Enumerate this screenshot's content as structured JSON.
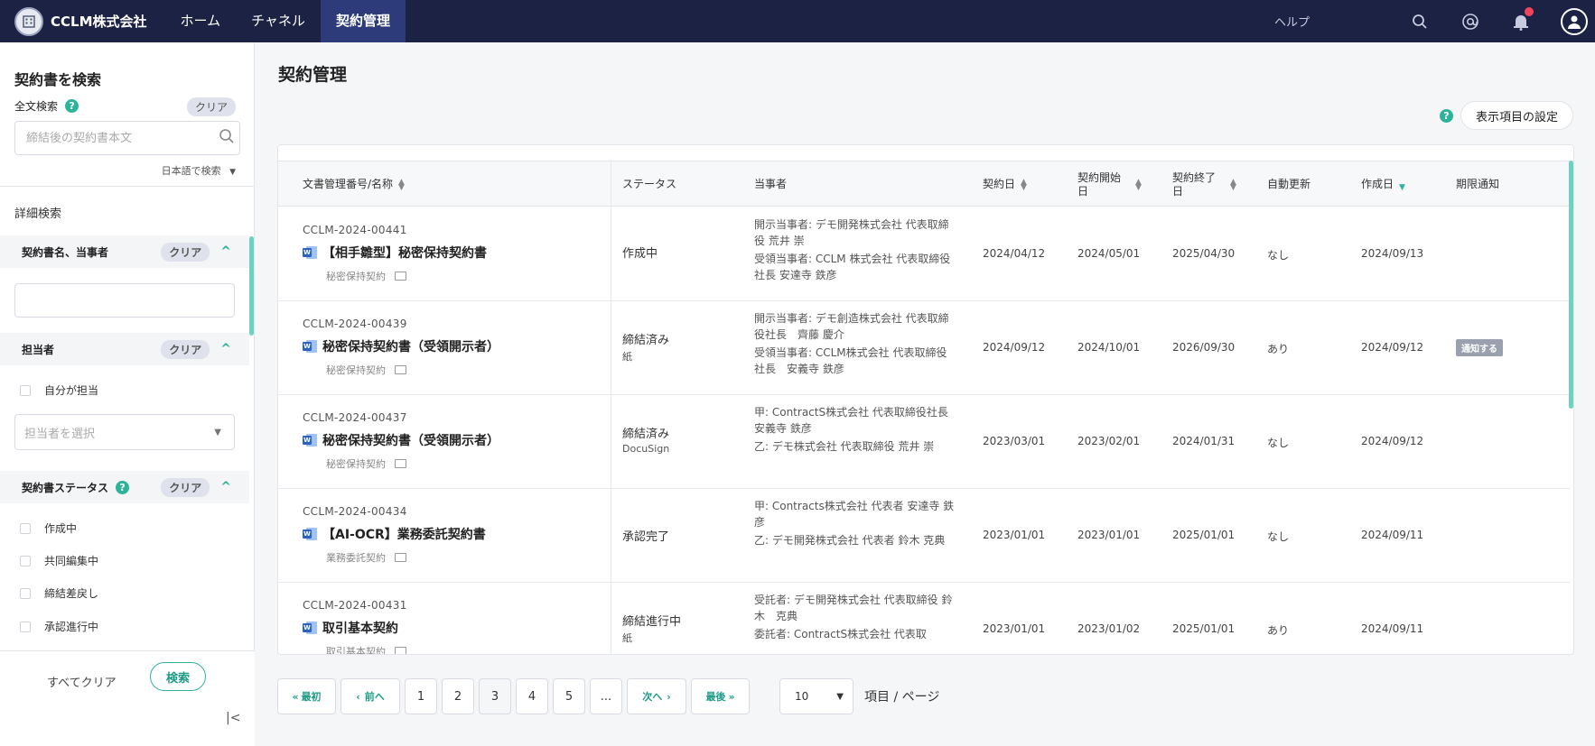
{
  "header": {
    "company": "CCLM株式会社",
    "nav": [
      {
        "label": "ホーム",
        "active": false
      },
      {
        "label": "チャネル",
        "active": false
      },
      {
        "label": "契約管理",
        "active": true
      }
    ],
    "help": "ヘルプ",
    "icons": [
      "building-icon",
      "search-icon",
      "mention-icon",
      "bell-icon",
      "user-icon"
    ],
    "colors": {
      "bar": "#1b2243",
      "active": "#2e3b7a",
      "accent": "#2fb29a",
      "notification": "#f0445b"
    }
  },
  "sidebar": {
    "title": "契約書を検索",
    "fulltext_label": "全文検索",
    "help_glyph": "?",
    "clear": "クリア",
    "search_placeholder": "締結後の契約書本文",
    "lang_select": "日本語で検索",
    "advanced_title": "詳細検索",
    "sections": {
      "name_party": {
        "title": "契約書名、当事者",
        "clear": "クリア"
      },
      "owner": {
        "title": "担当者",
        "clear": "クリア",
        "self_label": "自分が担当",
        "select_placeholder": "担当者を選択"
      },
      "status": {
        "title": "契約書ステータス",
        "clear": "クリア",
        "options": [
          "作成中",
          "共同編集中",
          "締結差戻し",
          "承認進行中"
        ]
      }
    },
    "clear_all": "すべてクリア",
    "search_button": "検索",
    "collapse_glyph": "|<"
  },
  "main": {
    "title": "契約管理",
    "help_glyph": "?",
    "display_settings": "表示項目の設定",
    "columns": {
      "doc": "文書管理番号/名称",
      "status": "ステータス",
      "parties": "当事者",
      "contract_date": "契約日",
      "start_date_1": "契約開始",
      "start_date_2": "日",
      "end_date_1": "契約終了",
      "end_date_2": "日",
      "auto_renew": "自動更新",
      "created": "作成日",
      "expiry_notice": "期限通知"
    },
    "rows": [
      {
        "no": "CCLM-2024-00441",
        "name": "【相手雛型】秘密保持契約書",
        "type": "秘密保持契約",
        "status": "作成中",
        "status_sub": "",
        "parties": [
          "開示当事者: デモ開発株式会社 代表取締役 荒井 崇",
          "受領当事者: CCLM 株式会社 代表取締役社長 安達寺 鉄彦"
        ],
        "contract_date": "2024/04/12",
        "start_date": "2024/05/01",
        "end_date": "2025/04/30",
        "auto_renew": "なし",
        "created": "2024/09/13",
        "notice": ""
      },
      {
        "no": "CCLM-2024-00439",
        "name": "秘密保持契約書（受領開示者）",
        "type": "秘密保持契約",
        "status": "締結済み",
        "status_sub": "紙",
        "parties": [
          "開示当事者: デモ創造株式会社 代表取締役社長　齊藤 慶介",
          "受領当事者: CCLM株式会社 代表取締役社長　安義寺 鉄彦"
        ],
        "contract_date": "2024/09/12",
        "start_date": "2024/10/01",
        "end_date": "2026/09/30",
        "auto_renew": "あり",
        "created": "2024/09/12",
        "notice": "通知する"
      },
      {
        "no": "CCLM-2024-00437",
        "name": "秘密保持契約書（受領開示者）",
        "type": "秘密保持契約",
        "status": "締結済み",
        "status_sub": "DocuSign",
        "parties": [
          "甲: ContractS株式会社 代表取締役社長 安義寺 鉄彦",
          "乙: デモ株式会社 代表取締役 荒井 崇"
        ],
        "contract_date": "2023/03/01",
        "start_date": "2023/02/01",
        "end_date": "2024/01/31",
        "auto_renew": "なし",
        "created": "2024/09/12",
        "notice": ""
      },
      {
        "no": "CCLM-2024-00434",
        "name": "【AI-OCR】業務委託契約書",
        "type": "業務委託契約",
        "status": "承認完了",
        "status_sub": "",
        "parties": [
          "甲: Contracts株式会社 代表者 安達寺 鉄彦",
          "乙: デモ開発株式会社 代表者 鈴木 克典"
        ],
        "contract_date": "2023/01/01",
        "start_date": "2023/01/01",
        "end_date": "2025/01/01",
        "auto_renew": "なし",
        "created": "2024/09/11",
        "notice": ""
      },
      {
        "no": "CCLM-2024-00431",
        "name": "取引基本契約",
        "type": "取引基本契約",
        "status": "締結進行中",
        "status_sub": "紙",
        "parties": [
          "受託者: デモ開発株式会社 代表取締役 鈴木　克典",
          "委託者: ContractS株式会社 代表取"
        ],
        "contract_date": "2023/01/01",
        "start_date": "2023/01/02",
        "end_date": "2025/01/01",
        "auto_renew": "あり",
        "created": "2024/09/11",
        "notice": ""
      }
    ],
    "pager": {
      "first": "最初",
      "prev": "前へ",
      "pages": [
        "1",
        "2",
        "3",
        "4",
        "5",
        "..."
      ],
      "current": "3",
      "next": "次へ",
      "last": "最後",
      "per_page": "10",
      "per_page_label": "項目 / ページ"
    }
  }
}
